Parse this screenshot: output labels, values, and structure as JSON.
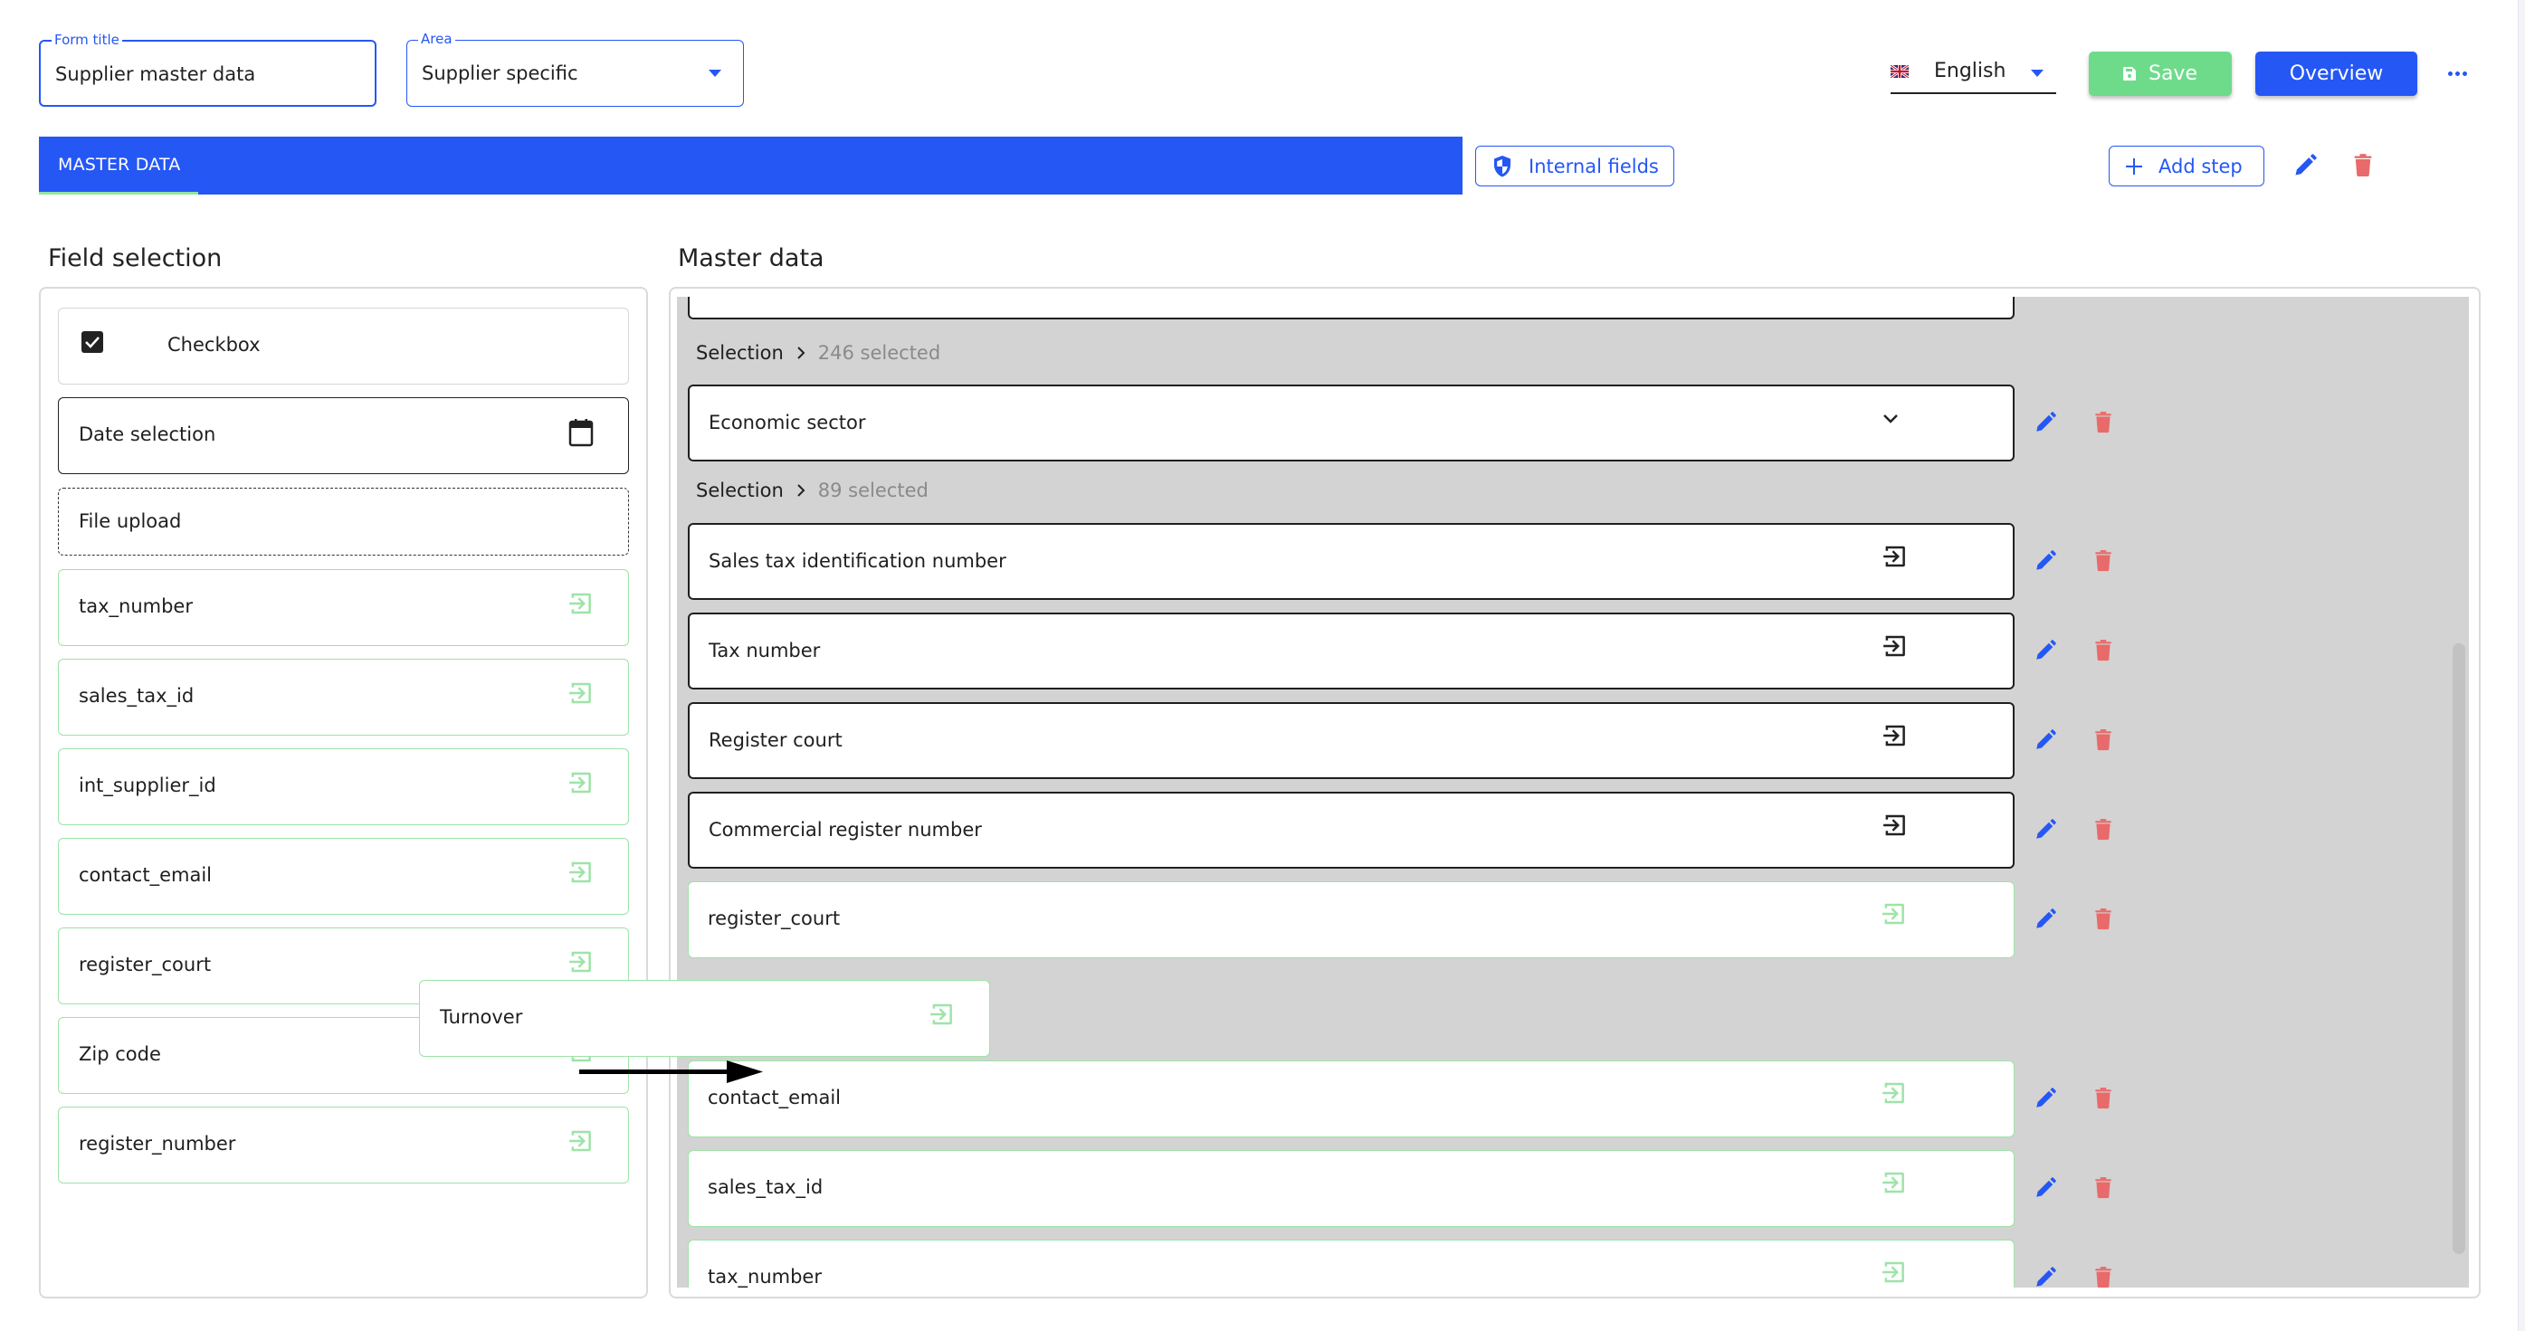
{
  "header": {
    "form_title": {
      "label": "Form title",
      "value": "Supplier master data"
    },
    "area": {
      "label": "Area",
      "value": "Supplier specific"
    },
    "language": {
      "value": "English",
      "flag_icon": "uk-flag-icon"
    },
    "save_label": "Save",
    "overview_label": "Overview",
    "more_icon": "more-horizontal-icon"
  },
  "tabs": [
    {
      "label": "MASTER DATA",
      "active": true
    }
  ],
  "toolbar": {
    "internal_fields_label": "Internal fields",
    "add_step_label": "Add step"
  },
  "colors": {
    "primary": "#2557f5",
    "success": "#6edb8b",
    "danger": "#e96a6a",
    "tab_indicator": "#8fe59f",
    "field_border_green": "#9ee3a8",
    "drop_zone": "#d3d3d3"
  },
  "field_selection": {
    "title": "Field selection",
    "items": [
      {
        "label": "Checkbox",
        "type": "checkbox",
        "icon": "checkbox-checked-icon"
      },
      {
        "label": "Date selection",
        "type": "date",
        "icon": "calendar-icon"
      },
      {
        "label": "File upload",
        "type": "file"
      },
      {
        "label": "tax_number",
        "type": "internal",
        "icon": "input-field-icon"
      },
      {
        "label": "sales_tax_id",
        "type": "internal",
        "icon": "input-field-icon"
      },
      {
        "label": "int_supplier_id",
        "type": "internal",
        "icon": "input-field-icon"
      },
      {
        "label": "contact_email",
        "type": "internal",
        "icon": "input-field-icon"
      },
      {
        "label": "register_court",
        "type": "internal",
        "icon": "input-field-icon"
      },
      {
        "label": "Zip code",
        "type": "internal",
        "icon": "input-field-icon"
      },
      {
        "label": "register_number",
        "type": "internal",
        "icon": "input-field-icon"
      }
    ]
  },
  "dragging_item": {
    "label": "Turnover",
    "icon": "input-field-icon"
  },
  "master_data": {
    "title": "Master data",
    "rows": [
      {
        "kind": "selection",
        "key": "Selection",
        "value": "246 selected"
      },
      {
        "kind": "field",
        "label": "Economic sector",
        "icon": "chevron-down-icon",
        "style": "dark"
      },
      {
        "kind": "selection",
        "key": "Selection",
        "value": "89 selected"
      },
      {
        "kind": "field",
        "label": "Sales tax identification number",
        "icon": "input-field-icon",
        "style": "dark"
      },
      {
        "kind": "field",
        "label": "Tax number",
        "icon": "input-field-icon",
        "style": "dark"
      },
      {
        "kind": "field",
        "label": "Register court",
        "icon": "input-field-icon",
        "style": "dark"
      },
      {
        "kind": "field",
        "label": "Commercial register number",
        "icon": "input-field-icon",
        "style": "dark"
      },
      {
        "kind": "field",
        "label": "register_court",
        "icon": "input-field-icon",
        "style": "green"
      },
      {
        "kind": "field",
        "label": "contact_email",
        "icon": "input-field-icon",
        "style": "green"
      },
      {
        "kind": "field",
        "label": "sales_tax_id",
        "icon": "input-field-icon",
        "style": "green"
      },
      {
        "kind": "field",
        "label": "tax_number",
        "icon": "input-field-icon",
        "style": "green"
      }
    ]
  }
}
